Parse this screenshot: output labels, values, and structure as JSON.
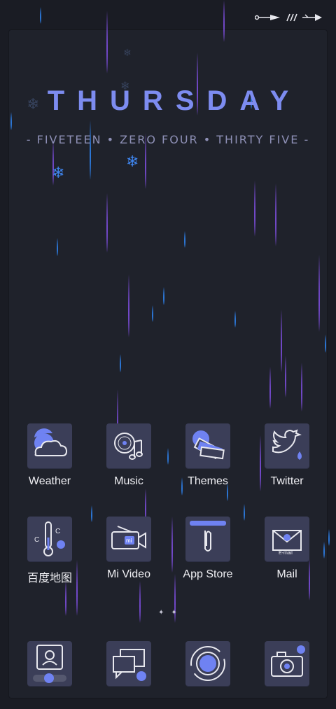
{
  "status_bar": {
    "icons": [
      "connector-arrow-icon",
      "signal-slashes-icon",
      "arrow-right-icon"
    ]
  },
  "clock": {
    "day": "THURSDAY",
    "time_words": "- FIVETEEN • ZERO FOUR • THIRTY FIVE -"
  },
  "apps_row1": [
    {
      "label": "Weather",
      "icon": "cloud-icon"
    },
    {
      "label": "Music",
      "icon": "music-disc-icon"
    },
    {
      "label": "Themes",
      "icon": "theme-swatches-icon"
    },
    {
      "label": "Twitter",
      "icon": "twitter-bird-icon"
    }
  ],
  "apps_row2": [
    {
      "label": "百度地图",
      "icon": "baidu-map-icon"
    },
    {
      "label": "Mi Video",
      "icon": "video-camera-icon"
    },
    {
      "label": "App Store",
      "icon": "paperclip-store-icon"
    },
    {
      "label": "Mail",
      "icon": "mail-envelope-icon"
    }
  ],
  "dock": [
    {
      "icon": "contacts-icon"
    },
    {
      "icon": "messages-icon"
    },
    {
      "icon": "browser-ring-icon"
    },
    {
      "icon": "camera-icon"
    }
  ],
  "colors": {
    "background": "#1f222b",
    "accent_blue": "#6f82f2",
    "rain_purple": "#7a4cd8",
    "rain_blue": "#2d7fe8",
    "tile": "#3b3e58"
  },
  "page_indicator": {
    "pages": 2,
    "current": 1
  }
}
